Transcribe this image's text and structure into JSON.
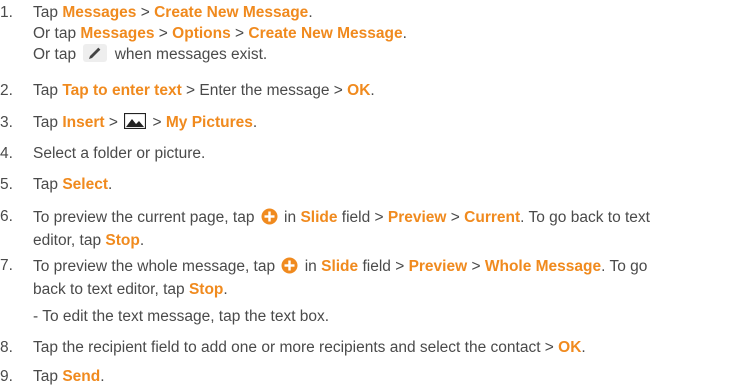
{
  "steps": [
    {
      "num": "1.",
      "lines": [
        [
          {
            "t": "Tap "
          },
          {
            "k": "Messages"
          },
          {
            "t": " > "
          },
          {
            "k": "Create New Message"
          },
          {
            "t": "."
          }
        ],
        [
          {
            "t": "Or tap "
          },
          {
            "k": "Messages"
          },
          {
            "t": " > "
          },
          {
            "k": "Options"
          },
          {
            "t": " > "
          },
          {
            "k": "Create New Message"
          },
          {
            "t": "."
          }
        ],
        [
          {
            "t": "Or tap "
          },
          {
            "icon": "pencil-icon"
          },
          {
            "t": " when messages exist."
          }
        ]
      ]
    },
    {
      "num": "2.",
      "lines": [
        [
          {
            "t": "Tap "
          },
          {
            "k": "Tap to enter text"
          },
          {
            "t": " > Enter the message > "
          },
          {
            "k": "OK"
          },
          {
            "t": "."
          }
        ]
      ]
    },
    {
      "num": "3.",
      "lines": [
        [
          {
            "t": "Tap "
          },
          {
            "k": "Insert"
          },
          {
            "t": " > "
          },
          {
            "icon": "picture-icon"
          },
          {
            "t": " > "
          },
          {
            "k": "My Pictures"
          },
          {
            "t": "."
          }
        ]
      ]
    },
    {
      "num": "4.",
      "lines": [
        [
          {
            "t": "Select a folder or picture."
          }
        ]
      ]
    },
    {
      "num": "5.",
      "lines": [
        [
          {
            "t": "Tap "
          },
          {
            "k": "Select"
          },
          {
            "t": "."
          }
        ]
      ]
    },
    {
      "num": "6.",
      "lines": [
        [
          {
            "t": "To preview the current page, tap "
          },
          {
            "icon": "plus-circle-icon"
          },
          {
            "t": " in "
          },
          {
            "k": "Slide"
          },
          {
            "t": " field > "
          },
          {
            "k": "Preview"
          },
          {
            "t": " > "
          },
          {
            "k": "Current"
          },
          {
            "t": ". To go back to text"
          }
        ],
        [
          {
            "t": "editor, tap "
          },
          {
            "k": "Stop"
          },
          {
            "t": "."
          }
        ]
      ]
    },
    {
      "num": "7.",
      "lines": [
        [
          {
            "t": "To preview the whole message, tap "
          },
          {
            "icon": "plus-circle-icon"
          },
          {
            "t": " in "
          },
          {
            "k": "Slide"
          },
          {
            "t": " field > "
          },
          {
            "k": "Preview"
          },
          {
            "t": " > "
          },
          {
            "k": "Whole Message"
          },
          {
            "t": ". To go"
          }
        ],
        [
          {
            "t": "back to text editor, tap "
          },
          {
            "k": "Stop"
          },
          {
            "t": "."
          }
        ]
      ]
    },
    {
      "num": "",
      "lines": [
        [
          {
            "t": "- To edit the text message, tap the text box."
          }
        ]
      ]
    },
    {
      "num": "8.",
      "lines": [
        [
          {
            "t": "Tap the recipient field to add one or more recipients and select the contact > "
          },
          {
            "k": "OK"
          },
          {
            "t": "."
          }
        ]
      ]
    },
    {
      "num": "9.",
      "lines": [
        [
          {
            "t": "Tap "
          },
          {
            "k": "Send"
          },
          {
            "t": "."
          }
        ]
      ]
    }
  ],
  "colors": {
    "keyword": "#f08a1e",
    "text": "#4a4a4a",
    "icon_plus": "#f08a1e"
  }
}
